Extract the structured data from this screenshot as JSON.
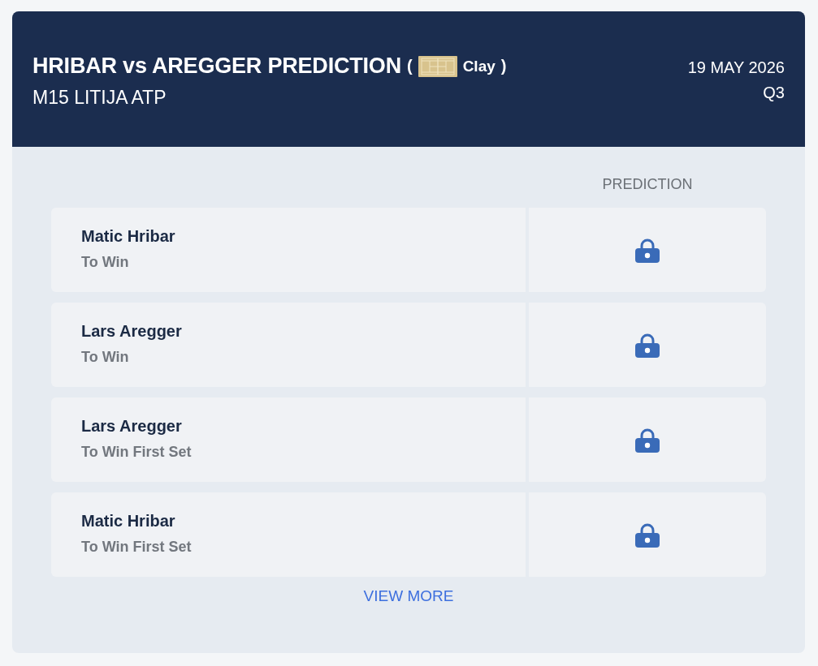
{
  "header": {
    "title": "HRIBAR vs AREGGER PREDICTION",
    "surface": {
      "open": "(",
      "label": "Clay",
      "close": ")"
    },
    "subtitle": "M15 LITIJA ATP",
    "date": "19 MAY 2026",
    "round": "Q3"
  },
  "table": {
    "column_header": "PREDICTION",
    "rows": [
      {
        "player": "Matic Hribar",
        "market": "To Win",
        "locked": true
      },
      {
        "player": "Lars Aregger",
        "market": "To Win",
        "locked": true
      },
      {
        "player": "Lars Aregger",
        "market": "To Win First Set",
        "locked": true
      },
      {
        "player": "Matic Hribar",
        "market": "To Win First Set",
        "locked": true
      }
    ]
  },
  "view_more": "VIEW MORE"
}
